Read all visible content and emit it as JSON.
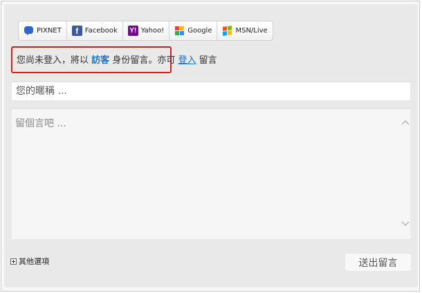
{
  "login_bar": {
    "providers": [
      {
        "label": "PIXNET",
        "icon": "pixnet-icon"
      },
      {
        "label": "Facebook",
        "icon": "facebook-icon"
      },
      {
        "label": "Yahoo!",
        "icon": "yahoo-icon"
      },
      {
        "label": "Google",
        "icon": "google-icon"
      },
      {
        "label": "MSN/Live",
        "icon": "msn-icon"
      }
    ]
  },
  "notice": {
    "prefix": "您尚未登入，將以",
    "guest_link": "訪客",
    "middle": "身份留言。",
    "suffix": "亦可",
    "login_link": "登入",
    "tail": "留言"
  },
  "form": {
    "nickname_placeholder": "您的暱稱 ...",
    "message_placeholder": "留個言吧 ...",
    "more_options": "其他選項",
    "submit_label": "送出留言"
  },
  "colors": {
    "highlight_border": "#d11f1f",
    "link": "#1a73c0",
    "panel_bg": "#e9e9e9"
  }
}
